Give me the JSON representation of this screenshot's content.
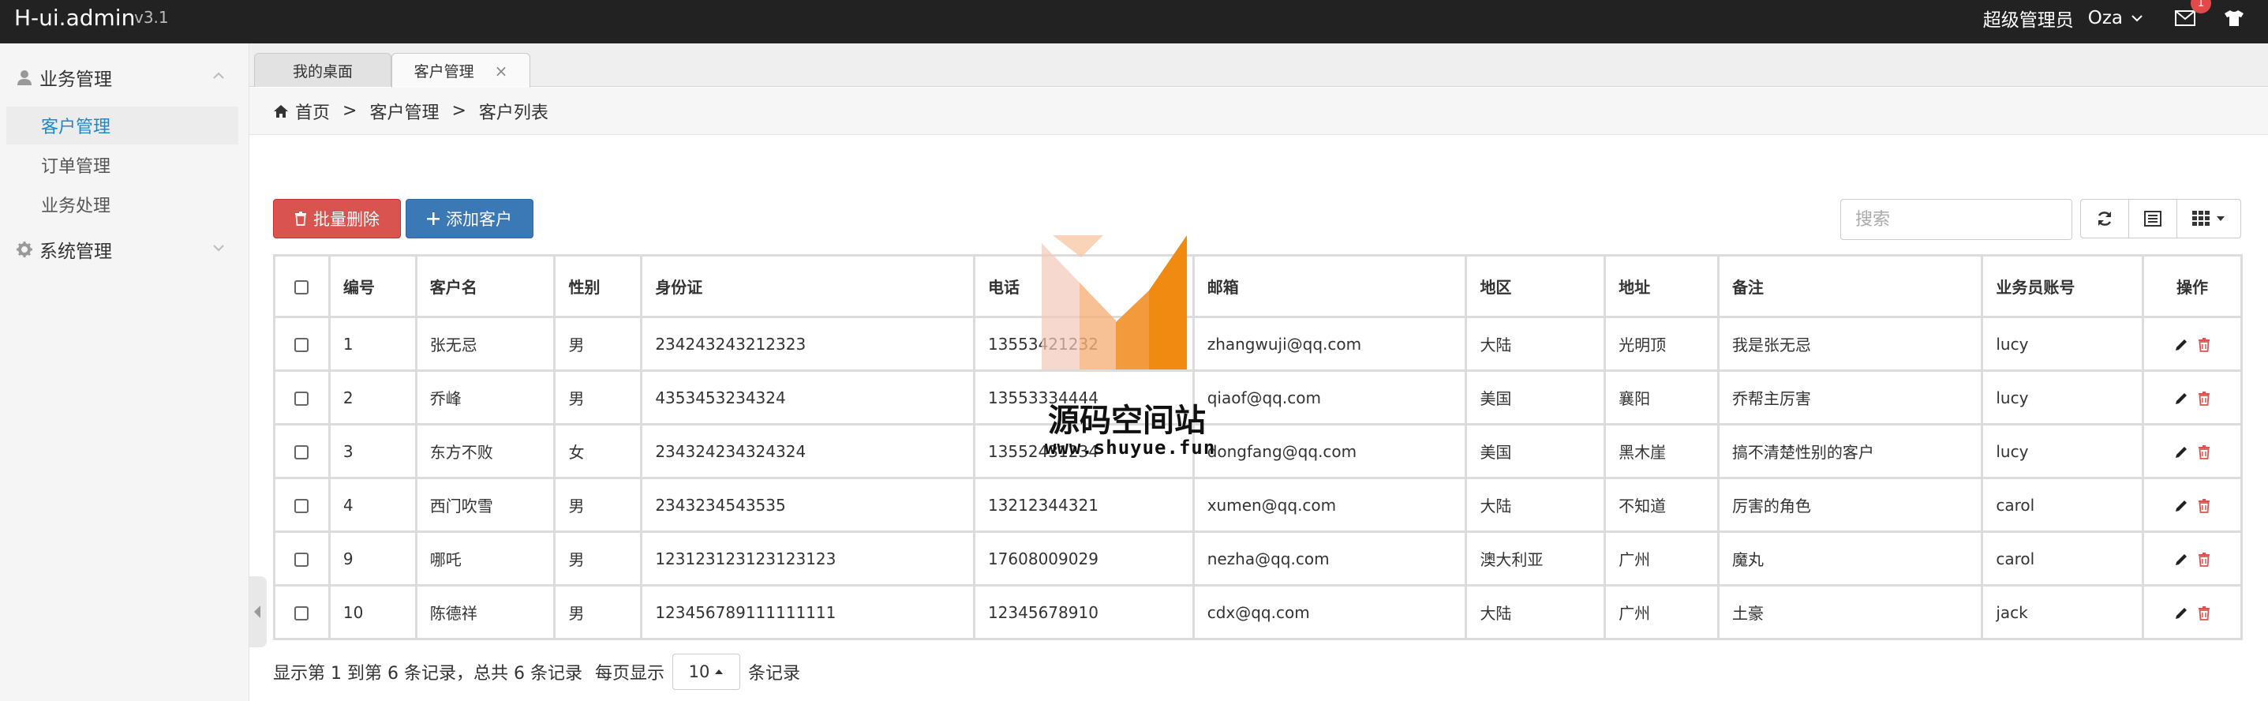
{
  "app": {
    "brand": "H-ui.admin",
    "version": "v3.1"
  },
  "topbar": {
    "role": "超级管理员",
    "user": "Oza",
    "mail_badge": "1",
    "icons": [
      "mail-icon",
      "shirt-icon"
    ]
  },
  "sidebar": {
    "groups": [
      {
        "label": "业务管理",
        "icon": "user-icon",
        "expanded": true,
        "items": [
          {
            "label": "客户管理",
            "active": true
          },
          {
            "label": "订单管理"
          },
          {
            "label": "业务处理"
          }
        ]
      },
      {
        "label": "系统管理",
        "icon": "gear-icon",
        "expanded": false,
        "items": []
      }
    ]
  },
  "tabs": [
    {
      "label": "我的桌面",
      "active": false
    },
    {
      "label": "客户管理",
      "active": true,
      "close": "×"
    }
  ],
  "breadcrumb": {
    "items": [
      "首页",
      "客户管理",
      "客户列表"
    ],
    "separator": ">"
  },
  "toolbar": {
    "batch_delete": "批量删除",
    "add_customer": "添加客户",
    "search_placeholder": "搜索"
  },
  "table": {
    "headers": [
      "编号",
      "客户名",
      "性别",
      "身份证",
      "电话",
      "邮箱",
      "地区",
      "地址",
      "备注",
      "业务员账号",
      "操作"
    ],
    "rows": [
      {
        "id": "1",
        "name": "张无忌",
        "gender": "男",
        "idcard": "234243243212323",
        "phone": "13553421232",
        "email": "zhangwuji@qq.com",
        "region": "大陆",
        "address": "光明顶",
        "note": "我是张无忌",
        "account": "lucy"
      },
      {
        "id": "2",
        "name": "乔峰",
        "gender": "男",
        "idcard": "4353453234324",
        "phone": "13553334444",
        "email": "qiaof@qq.com",
        "region": "美国",
        "address": "襄阳",
        "note": "乔帮主厉害",
        "account": "lucy"
      },
      {
        "id": "3",
        "name": "东方不败",
        "gender": "女",
        "idcard": "234324234324324",
        "phone": "13552431234",
        "email": "dongfang@qq.com",
        "region": "美国",
        "address": "黑木崖",
        "note": "搞不清楚性别的客户",
        "account": "lucy"
      },
      {
        "id": "4",
        "name": "西门吹雪",
        "gender": "男",
        "idcard": "2343234543535",
        "phone": "13212344321",
        "email": "xumen@qq.com",
        "region": "大陆",
        "address": "不知道",
        "note": "厉害的角色",
        "account": "carol"
      },
      {
        "id": "9",
        "name": "哪吒",
        "gender": "男",
        "idcard": "123123123123123123",
        "phone": "17608009029",
        "email": "nezha@qq.com",
        "region": "澳大利亚",
        "address": "广州",
        "note": "魔丸",
        "account": "carol"
      },
      {
        "id": "10",
        "name": "陈德祥",
        "gender": "男",
        "idcard": "123456789111111111",
        "phone": "12345678910",
        "email": "cdx@qq.com",
        "region": "大陆",
        "address": "广州",
        "note": "土豪",
        "account": "jack"
      }
    ]
  },
  "pager": {
    "summary": "显示第 1 到第 6 条记录，总共 6 条记录",
    "per_page_prefix": "每页显示",
    "page_size": "10",
    "per_page_suffix": "条记录"
  },
  "watermark": {
    "text": "源码空间站",
    "url": "www.shuyue.fun"
  },
  "colors": {
    "topbar": "#222222",
    "danger": "#d9534f",
    "primary": "#3a79b5",
    "active_menu_text": "#1e88c7",
    "delete_icon": "#d9534f"
  }
}
